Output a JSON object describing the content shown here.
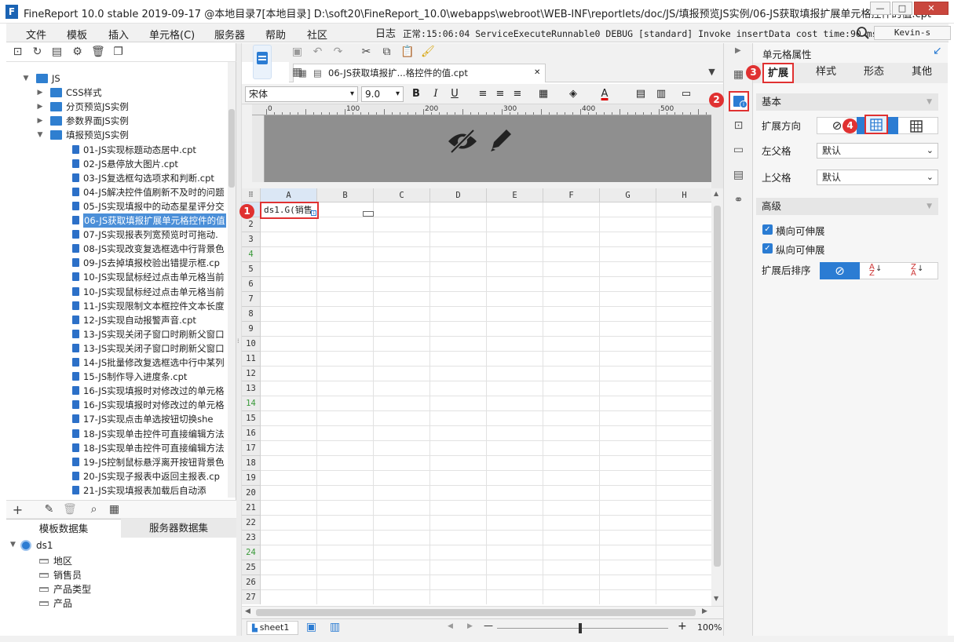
{
  "window": {
    "title": "FineReport 10.0 stable 2019-09-17 @本地目录7[本地目录]    D:\\soft20\\FineReport_10.0\\webapps\\webroot\\WEB-INF\\reportlets/doc/JS/填报预览JS实例/06-JS获取填报扩展单元格控件的值.cpt",
    "logo": "F",
    "min": "—",
    "max": "□",
    "close": "✕"
  },
  "menu": {
    "items": [
      "文件",
      "模板",
      "插入",
      "单元格(C)",
      "服务器",
      "帮助",
      "社区"
    ],
    "log_label": "日志",
    "status": "正常:15:06:04 ServiceExecuteRunnable0 DEBUG [standard] Invoke insertData cost time:90 ms",
    "user": "Kevin-s"
  },
  "tree": {
    "items": [
      {
        "label": "JS",
        "level": 1,
        "type": "folder",
        "expanded": true
      },
      {
        "label": "CSS样式",
        "level": 2,
        "type": "folder"
      },
      {
        "label": "分页预览JS实例",
        "level": 2,
        "type": "folder"
      },
      {
        "label": "参数界面JS实例",
        "level": 2,
        "type": "folder"
      },
      {
        "label": "填报预览JS实例",
        "level": 2,
        "type": "folder",
        "expanded": true
      },
      {
        "label": "01-JS实现标题动态居中.cpt",
        "level": 3,
        "type": "file"
      },
      {
        "label": "02-JS悬停放大图片.cpt",
        "level": 3,
        "type": "file"
      },
      {
        "label": "03-JS复选框勾选项求和判断.cpt",
        "level": 3,
        "type": "file"
      },
      {
        "label": "04-JS解决控件值刷新不及时的问题",
        "level": 3,
        "type": "file"
      },
      {
        "label": "05-JS实现填报中的动态星星评分交",
        "level": 3,
        "type": "file"
      },
      {
        "label": "06-JS获取填报扩展单元格控件的值",
        "level": 3,
        "type": "file",
        "selected": true
      },
      {
        "label": "07-JS实现报表列宽预览时可拖动.",
        "level": 3,
        "type": "file"
      },
      {
        "label": "08-JS实现改变复选框选中行背景色",
        "level": 3,
        "type": "file"
      },
      {
        "label": "09-JS去掉填报校验出错提示框.cp",
        "level": 3,
        "type": "file"
      },
      {
        "label": "10-JS实现鼠标经过点击单元格当前",
        "level": 3,
        "type": "file"
      },
      {
        "label": "10-JS实现鼠标经过点击单元格当前",
        "level": 3,
        "type": "file"
      },
      {
        "label": "11-JS实现限制文本框控件文本长度",
        "level": 3,
        "type": "file"
      },
      {
        "label": "12-JS实现自动报警声音.cpt",
        "level": 3,
        "type": "file"
      },
      {
        "label": "13-JS实现关闭子窗口时刷新父窗口",
        "level": 3,
        "type": "file"
      },
      {
        "label": "13-JS实现关闭子窗口时刷新父窗口",
        "level": 3,
        "type": "file"
      },
      {
        "label": "14-JS批量修改复选框选中行中某列",
        "level": 3,
        "type": "file"
      },
      {
        "label": "15-JS制作导入进度条.cpt",
        "level": 3,
        "type": "file"
      },
      {
        "label": "16-JS实现填报时对修改过的单元格",
        "level": 3,
        "type": "file"
      },
      {
        "label": "16-JS实现填报时对修改过的单元格",
        "level": 3,
        "type": "file"
      },
      {
        "label": "17-JS实现点击单选按钮切换she",
        "level": 3,
        "type": "file"
      },
      {
        "label": "18-JS实现单击控件可直接编辑方法",
        "level": 3,
        "type": "file"
      },
      {
        "label": "18-JS实现单击控件可直接编辑方法",
        "level": 3,
        "type": "file"
      },
      {
        "label": "19-JS控制鼠标悬浮离开按钮背景色",
        "level": 3,
        "type": "file"
      },
      {
        "label": "20-JS实现子报表中返回主报表.cp",
        "level": 3,
        "type": "file"
      },
      {
        "label": "21-JS实现填报表加载后自动添",
        "level": 3,
        "type": "file"
      }
    ]
  },
  "datasets": {
    "tab_template": "模板数据集",
    "tab_server": "服务器数据集",
    "root": "ds1",
    "fields": [
      "地区",
      "销售员",
      "产品类型",
      "产品"
    ]
  },
  "doc": {
    "tab_title": "06-JS获取填报扩...格控件的值.cpt",
    "tab_close": "✕"
  },
  "format": {
    "font": "宋体",
    "size": "9.0",
    "bold": "B",
    "italic": "I",
    "underline": "U"
  },
  "ruler": {
    "ticks": [
      "0",
      "100",
      "200",
      "300",
      "400",
      "500"
    ]
  },
  "sheet": {
    "columns": [
      "A",
      "B",
      "C",
      "D",
      "E",
      "F",
      "G",
      "H"
    ],
    "rows": [
      "1",
      "2",
      "3",
      "4",
      "5",
      "6",
      "7",
      "8",
      "9",
      "10",
      "11",
      "12",
      "13",
      "14",
      "15",
      "16",
      "17",
      "18",
      "19",
      "20",
      "21",
      "22",
      "23",
      "24",
      "25",
      "26",
      "27"
    ],
    "cell_a1": "ds1.G(销售",
    "tab": "sheet1",
    "zoom": "100%",
    "zoom_minus": "—",
    "zoom_plus": "+"
  },
  "panel": {
    "title": "单元格属性",
    "tabs": [
      "扩展",
      "样式",
      "形态",
      "其他"
    ],
    "section_basic": "基本",
    "expand_dir": "扩展方向",
    "left_parent": "左父格",
    "left_parent_value": "默认",
    "top_parent": "上父格",
    "top_parent_value": "默认",
    "section_adv": "高级",
    "h_expand": "横向可伸展",
    "v_expand": "纵向可伸展",
    "sort_after": "扩展后排序"
  },
  "badges": [
    "1",
    "2",
    "3",
    "4"
  ],
  "colors": {
    "accent": "#2b7cd3",
    "badge": "#e03131",
    "selection": "#4b8fd8"
  }
}
